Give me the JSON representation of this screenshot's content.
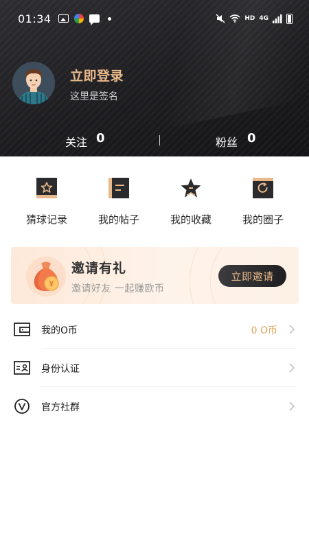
{
  "status_bar": {
    "time": "01:34",
    "network_label": "HD",
    "network_type": "4G",
    "icons": [
      "image-icon",
      "color-app-icon",
      "message-icon",
      "dot-icon",
      "mute-icon",
      "wifi-icon",
      "signal-icon",
      "battery-icon"
    ]
  },
  "profile": {
    "login_text": "立即登录",
    "signature": "这里是签名",
    "follow_label": "关注",
    "follow_count": "0",
    "fans_label": "粉丝",
    "fans_count": "0"
  },
  "quick_actions": [
    {
      "label": "猜球记录",
      "icon": "star-box-icon"
    },
    {
      "label": "我的帖子",
      "icon": "post-lines-icon"
    },
    {
      "label": "我的收藏",
      "icon": "star-favorite-icon"
    },
    {
      "label": "我的圈子",
      "icon": "refresh-circle-icon"
    }
  ],
  "invite_banner": {
    "title": "邀请有礼",
    "subtitle": "邀请好友   一起赚欧币",
    "button_label": "立即邀请",
    "icon": "money-bag-icon",
    "bag_symbol": "¥"
  },
  "menu": [
    {
      "label": "我的O币",
      "value": "0 O币",
      "icon": "wallet-icon"
    },
    {
      "label": "身份认证",
      "value": "",
      "icon": "id-card-icon"
    },
    {
      "label": "官方社群",
      "value": "",
      "icon": "v-circle-icon"
    }
  ],
  "colors": {
    "accent_gold": "#e8b98a",
    "coin_value": "#e0a35a",
    "header_dark": "#1d1d20",
    "banner_bg": "#fde9d9"
  }
}
